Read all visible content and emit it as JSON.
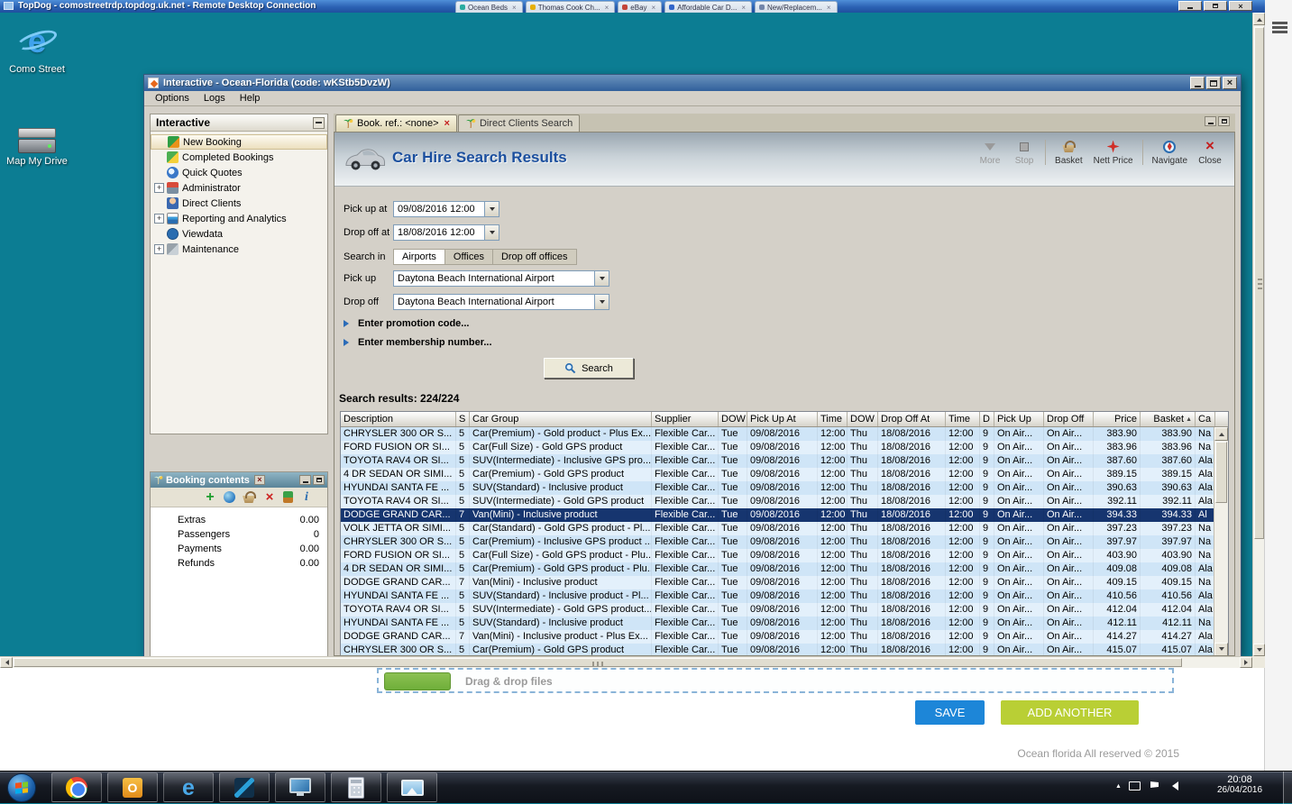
{
  "rdp": {
    "title": "TopDog - comostreetrdp.topdog.uk.net - Remote Desktop Connection",
    "background_tabs": [
      {
        "label": "Ocean Beds"
      },
      {
        "label": "Thomas Cook Ch..."
      },
      {
        "label": "eBay"
      },
      {
        "label": "Affordable Car D..."
      },
      {
        "label": "New/Replacem..."
      }
    ]
  },
  "desktop": {
    "icons": [
      {
        "label": "Como Street"
      },
      {
        "label": "Map My Drive"
      }
    ]
  },
  "app_window": {
    "title": "Interactive - Ocean-Florida (code: wKStb5DvzW)",
    "menu": [
      "Options",
      "Logs",
      "Help"
    ],
    "sidebar": {
      "title": "Interactive",
      "items": [
        {
          "label": "New Booking",
          "icon": "new-booking-icon",
          "selected": true
        },
        {
          "label": "Completed Bookings",
          "icon": "completed-bookings-icon"
        },
        {
          "label": "Quick Quotes",
          "icon": "quick-quotes-icon"
        },
        {
          "label": "Administrator",
          "icon": "administrator-icon",
          "expandable": true
        },
        {
          "label": "Direct Clients",
          "icon": "direct-clients-icon"
        },
        {
          "label": "Reporting and Analytics",
          "icon": "reporting-icon",
          "expandable": true
        },
        {
          "label": "Viewdata",
          "icon": "viewdata-icon"
        },
        {
          "label": "Maintenance",
          "icon": "maintenance-icon",
          "expandable": true
        }
      ]
    },
    "booking_contents": {
      "title": "Booking contents",
      "toolbar_icons": [
        "add-icon",
        "world-icon",
        "basket-icon",
        "delete-icon",
        "palmtree-icon",
        "info-icon"
      ],
      "rows": [
        {
          "label": "Extras",
          "value": "0.00"
        },
        {
          "label": "Passengers",
          "value": "0"
        },
        {
          "label": "Payments",
          "value": "0.00"
        },
        {
          "label": "Refunds",
          "value": "0.00"
        }
      ]
    },
    "tabs": [
      {
        "label": "Book. ref.: <none>",
        "active": true,
        "closable": true
      },
      {
        "label": "Direct Clients Search",
        "active": false
      }
    ],
    "page": {
      "title": "Car Hire Search Results",
      "toolbar": [
        {
          "label": "More",
          "icon": "more-icon",
          "disabled": true
        },
        {
          "label": "Stop",
          "icon": "stop-icon",
          "disabled": true
        },
        {
          "label": "Basket",
          "icon": "basket-icon"
        },
        {
          "label": "Nett Price",
          "icon": "nett-price-icon"
        },
        {
          "label": "Navigate",
          "icon": "navigate-icon"
        },
        {
          "label": "Close",
          "icon": "close-icon"
        }
      ],
      "form": {
        "pickup_at_label": "Pick up at",
        "pickup_at_value": "09/08/2016 12:00",
        "dropoff_at_label": "Drop off at",
        "dropoff_at_value": "18/08/2016 12:00",
        "search_in_label": "Search in",
        "search_in_tabs": [
          "Airports",
          "Offices",
          "Drop off offices"
        ],
        "pickup_label": "Pick up",
        "pickup_value": "Daytona Beach International Airport",
        "dropoff_label": "Drop off",
        "dropoff_value": "Daytona Beach International Airport",
        "promo_label": "Enter promotion code...",
        "membership_label": "Enter membership number...",
        "search_button": "Search"
      },
      "results_label": "Search results: 224/224",
      "grid": {
        "columns": [
          {
            "label": "Description"
          },
          {
            "label": "S"
          },
          {
            "label": "Car Group"
          },
          {
            "label": "Supplier"
          },
          {
            "label": "DOW"
          },
          {
            "label": "Pick Up At"
          },
          {
            "label": "Time"
          },
          {
            "label": "DOW"
          },
          {
            "label": "Drop Off At"
          },
          {
            "label": "Time"
          },
          {
            "label": "D"
          },
          {
            "label": "Pick Up"
          },
          {
            "label": "Drop Off"
          },
          {
            "label": "Price"
          },
          {
            "label": "Basket",
            "sort": "asc"
          },
          {
            "label": "Ca"
          }
        ],
        "selected_row": 6,
        "rows": [
          [
            "CHRYSLER 300 OR S...",
            "5",
            "Car(Premium) - Gold product - Plus Ex...",
            "Flexible Car...",
            "Tue",
            "09/08/2016",
            "12:00",
            "Thu",
            "18/08/2016",
            "12:00",
            "9",
            "On Air...",
            "On Air...",
            "383.90",
            "383.90",
            "Na"
          ],
          [
            "FORD FUSION OR SI...",
            "5",
            "Car(Full Size) - Gold GPS product",
            "Flexible Car...",
            "Tue",
            "09/08/2016",
            "12:00",
            "Thu",
            "18/08/2016",
            "12:00",
            "9",
            "On Air...",
            "On Air...",
            "383.96",
            "383.96",
            "Na"
          ],
          [
            "TOYOTA RAV4 OR SI...",
            "5",
            "SUV(Intermediate) - Inclusive GPS pro...",
            "Flexible Car...",
            "Tue",
            "09/08/2016",
            "12:00",
            "Thu",
            "18/08/2016",
            "12:00",
            "9",
            "On Air...",
            "On Air...",
            "387.60",
            "387.60",
            "Ala"
          ],
          [
            "4 DR SEDAN OR SIMI...",
            "5",
            "Car(Premium) - Gold GPS product",
            "Flexible Car...",
            "Tue",
            "09/08/2016",
            "12:00",
            "Thu",
            "18/08/2016",
            "12:00",
            "9",
            "On Air...",
            "On Air...",
            "389.15",
            "389.15",
            "Ala"
          ],
          [
            "HYUNDAI SANTA FE ...",
            "5",
            "SUV(Standard) - Inclusive product",
            "Flexible Car...",
            "Tue",
            "09/08/2016",
            "12:00",
            "Thu",
            "18/08/2016",
            "12:00",
            "9",
            "On Air...",
            "On Air...",
            "390.63",
            "390.63",
            "Ala"
          ],
          [
            "TOYOTA RAV4 OR SI...",
            "5",
            "SUV(Intermediate) - Gold GPS product",
            "Flexible Car...",
            "Tue",
            "09/08/2016",
            "12:00",
            "Thu",
            "18/08/2016",
            "12:00",
            "9",
            "On Air...",
            "On Air...",
            "392.11",
            "392.11",
            "Ala"
          ],
          [
            "DODGE GRAND CAR...",
            "7",
            "Van(Mini) - Inclusive product",
            "Flexible Car...",
            "Tue",
            "09/08/2016",
            "12:00",
            "Thu",
            "18/08/2016",
            "12:00",
            "9",
            "On Air...",
            "On Air...",
            "394.33",
            "394.33",
            "Al"
          ],
          [
            "VOLK JETTA OR SIMI...",
            "5",
            "Car(Standard) - Gold GPS product - Pl...",
            "Flexible Car...",
            "Tue",
            "09/08/2016",
            "12:00",
            "Thu",
            "18/08/2016",
            "12:00",
            "9",
            "On Air...",
            "On Air...",
            "397.23",
            "397.23",
            "Na"
          ],
          [
            "CHRYSLER 300 OR S...",
            "5",
            "Car(Premium) - Inclusive GPS product ...",
            "Flexible Car...",
            "Tue",
            "09/08/2016",
            "12:00",
            "Thu",
            "18/08/2016",
            "12:00",
            "9",
            "On Air...",
            "On Air...",
            "397.97",
            "397.97",
            "Na"
          ],
          [
            "FORD FUSION OR SI...",
            "5",
            "Car(Full Size) - Gold GPS product - Plu...",
            "Flexible Car...",
            "Tue",
            "09/08/2016",
            "12:00",
            "Thu",
            "18/08/2016",
            "12:00",
            "9",
            "On Air...",
            "On Air...",
            "403.90",
            "403.90",
            "Na"
          ],
          [
            "4 DR SEDAN OR SIMI...",
            "5",
            "Car(Premium) - Gold GPS product - Plu...",
            "Flexible Car...",
            "Tue",
            "09/08/2016",
            "12:00",
            "Thu",
            "18/08/2016",
            "12:00",
            "9",
            "On Air...",
            "On Air...",
            "409.08",
            "409.08",
            "Ala"
          ],
          [
            "DODGE GRAND CAR...",
            "7",
            "Van(Mini) - Inclusive product",
            "Flexible Car...",
            "Tue",
            "09/08/2016",
            "12:00",
            "Thu",
            "18/08/2016",
            "12:00",
            "9",
            "On Air...",
            "On Air...",
            "409.15",
            "409.15",
            "Na"
          ],
          [
            "HYUNDAI SANTA FE ...",
            "5",
            "SUV(Standard) - Inclusive product - Pl...",
            "Flexible Car...",
            "Tue",
            "09/08/2016",
            "12:00",
            "Thu",
            "18/08/2016",
            "12:00",
            "9",
            "On Air...",
            "On Air...",
            "410.56",
            "410.56",
            "Ala"
          ],
          [
            "TOYOTA RAV4 OR SI...",
            "5",
            "SUV(Intermediate) - Gold GPS product...",
            "Flexible Car...",
            "Tue",
            "09/08/2016",
            "12:00",
            "Thu",
            "18/08/2016",
            "12:00",
            "9",
            "On Air...",
            "On Air...",
            "412.04",
            "412.04",
            "Ala"
          ],
          [
            "HYUNDAI SANTA FE ...",
            "5",
            "SUV(Standard) - Inclusive product",
            "Flexible Car...",
            "Tue",
            "09/08/2016",
            "12:00",
            "Thu",
            "18/08/2016",
            "12:00",
            "9",
            "On Air...",
            "On Air...",
            "412.11",
            "412.11",
            "Na"
          ],
          [
            "DODGE GRAND CAR...",
            "7",
            "Van(Mini) - Inclusive product - Plus Ex...",
            "Flexible Car...",
            "Tue",
            "09/08/2016",
            "12:00",
            "Thu",
            "18/08/2016",
            "12:00",
            "9",
            "On Air...",
            "On Air...",
            "414.27",
            "414.27",
            "Ala"
          ],
          [
            "CHRYSLER 300 OR S...",
            "5",
            "Car(Premium) - Gold GPS product",
            "Flexible Car...",
            "Tue",
            "09/08/2016",
            "12:00",
            "Thu",
            "18/08/2016",
            "12:00",
            "9",
            "On Air...",
            "On Air...",
            "415.07",
            "415.07",
            "Ala"
          ]
        ]
      }
    }
  },
  "background_page": {
    "dropzone_text": "Drag & drop files",
    "save_button": "SAVE",
    "add_another_button": "ADD ANOTHER",
    "footer": "Ocean florida All reserved © 2015"
  },
  "taskbar": {
    "time": "20:08",
    "date": "26/04/2016"
  }
}
